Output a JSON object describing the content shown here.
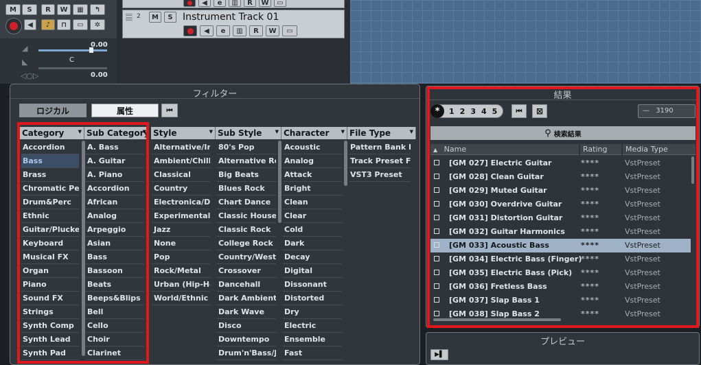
{
  "transport": {
    "m_label": "M",
    "s_label": "S",
    "r_label": "R",
    "w_label": "W",
    "value1": "0.00",
    "center_label": "C",
    "value2": "0.00"
  },
  "tracks": {
    "track2_number": "2",
    "track2_name": "Instrument Track 01",
    "m_label": "M",
    "s_label": "S",
    "e_label": "e",
    "r_label": "R",
    "w_label": "W"
  },
  "filter": {
    "title": "フィルター",
    "tab_logical": "ロジカル",
    "tab_attributes": "属性",
    "columns": [
      {
        "header": "Category",
        "items": [
          "Accordion",
          "Bass",
          "Brass",
          "Chromatic Perc",
          "Drum&Perc",
          "Ethnic",
          "Guitar/Plucked",
          "Keyboard",
          "Musical FX",
          "Organ",
          "Piano",
          "Sound FX",
          "Strings",
          "Synth Comp",
          "Synth Lead",
          "Synth Pad"
        ]
      },
      {
        "header": "Sub Category",
        "items": [
          "A. Bass",
          "A. Guitar",
          "A. Piano",
          "Accordion",
          "African",
          "Analog",
          "Arpeggio",
          "Asian",
          "Bass",
          "Bassoon",
          "Beats",
          "Beeps&Blips",
          "Bell",
          "Cello",
          "Choir",
          "Clarinet"
        ]
      },
      {
        "header": "Style",
        "items": [
          "Alternative/Indie",
          "Ambient/ChillOut",
          "Classical",
          "Country",
          "Electronica/Dance",
          "Experimental",
          "Jazz",
          "None",
          "Pop",
          "Rock/Metal",
          "Urban (Hip-Hop / R",
          "World/Ethnic"
        ]
      },
      {
        "header": "Sub Style",
        "items": [
          "80's Pop",
          "Alternative Rock",
          "Big Beats",
          "Blues Rock",
          "Chart Dance",
          "Classic House",
          "Classic Rock",
          "College Rock",
          "Country/Western",
          "Crossover",
          "Dancehall",
          "Dark Ambient",
          "Dark Wave",
          "Disco",
          "Downtempo",
          "Drum'n'Bass/Jun"
        ]
      },
      {
        "header": "Character",
        "items": [
          "Acoustic",
          "Analog",
          "Attack",
          "Bright",
          "Clean",
          "Clear",
          "Cold",
          "Dark",
          "Decay",
          "Digital",
          "Dissonant",
          "Distorted",
          "Dry",
          "Electric",
          "Ensemble",
          "Fast"
        ]
      },
      {
        "header": "File Type",
        "items": [
          "Pattern Bank File",
          "Track Preset File",
          "VST3 Preset"
        ]
      }
    ]
  },
  "results": {
    "title": "結果",
    "rating_filter": [
      "*",
      "1",
      "2",
      "3",
      "4",
      "5"
    ],
    "count": "3190",
    "search_label": "検索結果",
    "col_name": "Name",
    "col_rating": "Rating",
    "col_media": "Media Type",
    "rows": [
      {
        "name": "[GM 027] Electric Guitar",
        "rating": "****",
        "media": "VstPreset"
      },
      {
        "name": "[GM 028] Clean Guitar",
        "rating": "****",
        "media": "VstPreset"
      },
      {
        "name": "[GM 029] Muted Guitar",
        "rating": "****",
        "media": "VstPreset"
      },
      {
        "name": "[GM 030] Overdrive Guitar",
        "rating": "****",
        "media": "VstPreset"
      },
      {
        "name": "[GM 031] Distortion Guitar",
        "rating": "****",
        "media": "VstPreset"
      },
      {
        "name": "[GM 032] Guitar Harmonics",
        "rating": "****",
        "media": "VstPreset"
      },
      {
        "name": "[GM 033] Acoustic Bass",
        "rating": "****",
        "media": "VstPreset"
      },
      {
        "name": "[GM 034] Electric Bass (Finger)",
        "rating": "****",
        "media": "VstPreset"
      },
      {
        "name": "[GM 035] Electric Bass (Pick)",
        "rating": "****",
        "media": "VstPreset"
      },
      {
        "name": "[GM 036] Fretless Bass",
        "rating": "****",
        "media": "VstPreset"
      },
      {
        "name": "[GM 037] Slap Bass 1",
        "rating": "****",
        "media": "VstPreset"
      },
      {
        "name": "[GM 038] Slap Bass 2",
        "rating": "****",
        "media": "VstPreset"
      }
    ]
  },
  "preview": {
    "title": "プレビュー"
  },
  "colors": {
    "highlight_red": "#e0171d",
    "selection_blue": "#3b4e66",
    "result_selected": "#9fb2c7"
  }
}
